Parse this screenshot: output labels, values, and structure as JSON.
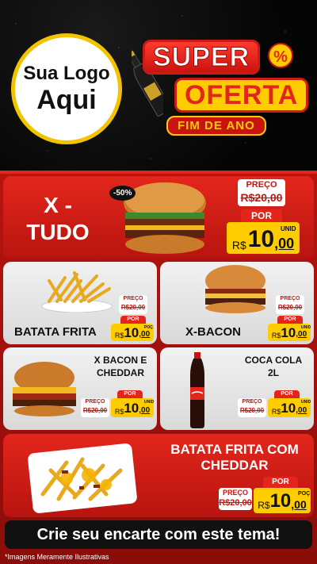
{
  "header": {
    "logo_line1": "Sua Logo",
    "logo_line2": "Aqui",
    "promo_super": "SUPER",
    "promo_oferta": "OFERTA",
    "promo_pct": "%",
    "promo_fim": "FIM DE ANO"
  },
  "products": [
    {
      "title_line1": "X -",
      "title_line2": "TUDO",
      "badge": "-50%",
      "old_label": "PREÇO",
      "old_price": "R$20,00",
      "por": "POR",
      "currency": "R$",
      "price_int": "10",
      "price_cents": ",00",
      "unit": "UNID"
    },
    {
      "title": "BATATA FRITA",
      "old_label": "PREÇO",
      "old_price": "R$20,00",
      "por": "POR",
      "currency": "R$",
      "price_int": "10",
      "price_cents": ",00",
      "unit": "POÇ"
    },
    {
      "title": "X-BACON",
      "old_label": "PREÇO",
      "old_price": "R$20,00",
      "por": "POR",
      "currency": "R$",
      "price_int": "10",
      "price_cents": ",00",
      "unit": "UNID"
    },
    {
      "title_line1": "X BACON E",
      "title_line2": "CHEDDAR",
      "old_label": "PREÇO",
      "old_price": "R$20,00",
      "por": "POR",
      "currency": "R$",
      "price_int": "10",
      "price_cents": ",00",
      "unit": "UNID"
    },
    {
      "title_line1": "COCA COLA",
      "title_line2": "2L",
      "old_label": "PREÇO",
      "old_price": "R$20,00",
      "por": "POR",
      "currency": "R$",
      "price_int": "10",
      "price_cents": ",00",
      "unit": "UNID"
    },
    {
      "title_line1": "BATATA FRITA COM",
      "title_line2": "CHEDDAR",
      "old_label": "PREÇO",
      "old_price": "R$20,00",
      "por": "POR",
      "currency": "R$",
      "price_int": "10",
      "price_cents": ",00",
      "unit": "POÇ"
    }
  ],
  "cta": "Crie seu encarte com este tema!",
  "footnote": "*Imagens Meramente Ilustrativas",
  "colors": {
    "red": "#e3261c",
    "yellow": "#ffcc00",
    "dark_red": "#b8140f"
  },
  "icons": [
    "wine-bottle-icon",
    "burger-image",
    "fries-image",
    "coca-cola-bottle-image",
    "cheddar-fries-image"
  ]
}
